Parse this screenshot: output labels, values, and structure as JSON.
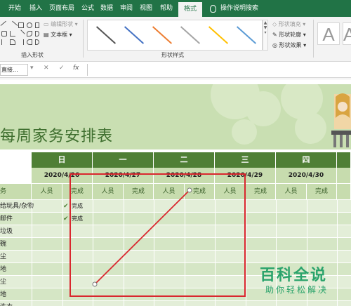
{
  "ribbon_tabs": [
    "开始",
    "插入",
    "页面布局",
    "公式",
    "数据",
    "审阅",
    "视图",
    "帮助",
    "格式"
  ],
  "tell_me": "操作说明搜索",
  "ribbon": {
    "edit_shape": "编辑形状",
    "text_box": "文本框",
    "insert_shapes_group": "插入形状",
    "shape_styles_group": "形状样式",
    "shape_fill": "形状填充",
    "shape_outline": "形状轮廓",
    "shape_effects": "形状效果",
    "wordart_letter": "A"
  },
  "formula_bar": {
    "name_box": "直接...",
    "fx": "fx",
    "cancel": "✕",
    "enter": "✓"
  },
  "sheet": {
    "title": "每周家务安排表",
    "days": [
      "日",
      "一",
      "二",
      "三",
      "四"
    ],
    "dates": [
      "2020/4/26",
      "2020/4/27",
      "2020/4/28",
      "2020/4/29",
      "2020/4/30"
    ],
    "task_header": "务",
    "person_label": "人员",
    "done_label": "完成",
    "tasks": [
      "给玩具/杂物",
      "邮件",
      "垃圾",
      "碗",
      "尘",
      "地",
      "尘",
      "地",
      "洗衣"
    ],
    "completed": [
      "完成",
      "完成"
    ]
  },
  "watermark": {
    "main": "百科全说",
    "sub": "助你轻松解决"
  },
  "colors": {
    "ribbon_green": "#217346",
    "header_green": "#4f7f35",
    "light_green": "#c7dcae",
    "annotation_red": "#d9272e",
    "watermark_green": "#2aa36b"
  }
}
